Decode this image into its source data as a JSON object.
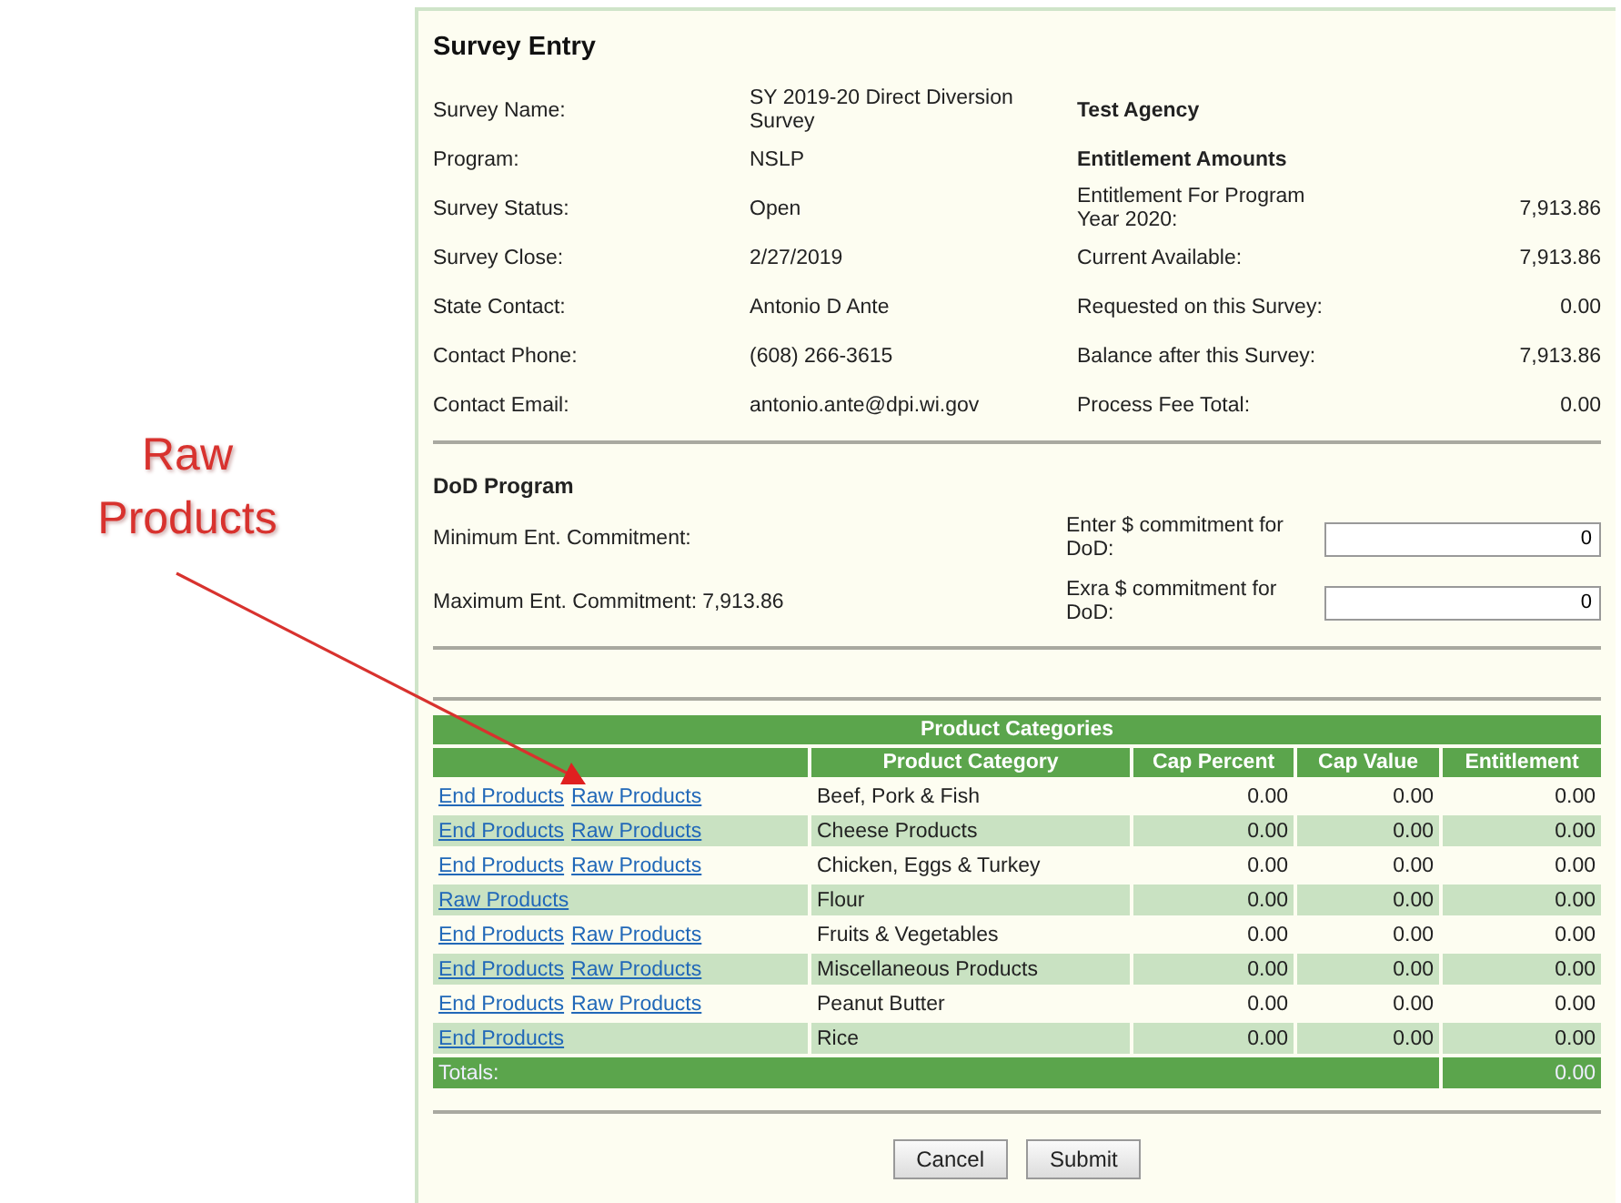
{
  "annotation": {
    "text": "Raw Products"
  },
  "panel": {
    "title": "Survey Entry"
  },
  "info_rows": [
    {
      "label": "Survey Name:",
      "value": "SY 2019-20 Direct Diversion Survey",
      "right": {
        "kind": "heading",
        "text": "Test Agency"
      }
    },
    {
      "label": "Program:",
      "value": "NSLP",
      "right": {
        "kind": "heading",
        "text": "Entitlement Amounts"
      }
    },
    {
      "label": "Survey Status:",
      "value": "Open",
      "right": {
        "kind": "amount",
        "label": "Entitlement For Program Year 2020:",
        "value": "7,913.86"
      }
    },
    {
      "label": "Survey Close:",
      "value": "2/27/2019",
      "right": {
        "kind": "amount",
        "label": "Current Available:",
        "value": "7,913.86"
      }
    },
    {
      "label": "State Contact:",
      "value": "Antonio D Ante",
      "right": {
        "kind": "amount",
        "label": "Requested on this Survey:",
        "value": "0.00"
      }
    },
    {
      "label": "Contact Phone:",
      "value": "(608) 266-3615",
      "right": {
        "kind": "amount",
        "label": "Balance after this Survey:",
        "value": "7,913.86"
      }
    },
    {
      "label": "Contact Email:",
      "value": "antonio.ante@dpi.wi.gov",
      "right": {
        "kind": "amount",
        "label": "Process Fee Total:",
        "value": "0.00"
      }
    }
  ],
  "dod": {
    "title": "DoD Program",
    "rows": [
      {
        "label": "Minimum Ent. Commitment:",
        "input_label": "Enter $ commitment for DoD:",
        "input_value": "0"
      },
      {
        "label": "Maximum Ent. Commitment:",
        "value": "7,913.86",
        "input_label": "Exra $ commitment for DoD:",
        "input_value": "0"
      }
    ]
  },
  "table": {
    "title": "Product Categories",
    "columns": [
      "Product Category",
      "Cap Percent",
      "Cap Value",
      "Entitlement"
    ],
    "rows": [
      {
        "links": [
          "End Products",
          "Raw Products"
        ],
        "category": "Beef, Pork & Fish",
        "cap_percent": "0.00",
        "cap_value": "0.00",
        "entitlement": "0.00"
      },
      {
        "links": [
          "End Products",
          "Raw Products"
        ],
        "category": "Cheese Products",
        "cap_percent": "0.00",
        "cap_value": "0.00",
        "entitlement": "0.00"
      },
      {
        "links": [
          "End Products",
          "Raw Products"
        ],
        "category": "Chicken, Eggs & Turkey",
        "cap_percent": "0.00",
        "cap_value": "0.00",
        "entitlement": "0.00"
      },
      {
        "links": [
          "Raw Products"
        ],
        "category": "Flour",
        "cap_percent": "0.00",
        "cap_value": "0.00",
        "entitlement": "0.00"
      },
      {
        "links": [
          "End Products",
          "Raw Products"
        ],
        "category": "Fruits & Vegetables",
        "cap_percent": "0.00",
        "cap_value": "0.00",
        "entitlement": "0.00"
      },
      {
        "links": [
          "End Products",
          "Raw Products"
        ],
        "category": "Miscellaneous Products",
        "cap_percent": "0.00",
        "cap_value": "0.00",
        "entitlement": "0.00"
      },
      {
        "links": [
          "End Products",
          "Raw Products"
        ],
        "category": "Peanut Butter",
        "cap_percent": "0.00",
        "cap_value": "0.00",
        "entitlement": "0.00"
      },
      {
        "links": [
          "End Products"
        ],
        "category": "Rice",
        "cap_percent": "0.00",
        "cap_value": "0.00",
        "entitlement": "0.00"
      }
    ],
    "totals": {
      "label": "Totals:",
      "value": "0.00"
    }
  },
  "buttons": [
    "Cancel",
    "Submit"
  ]
}
